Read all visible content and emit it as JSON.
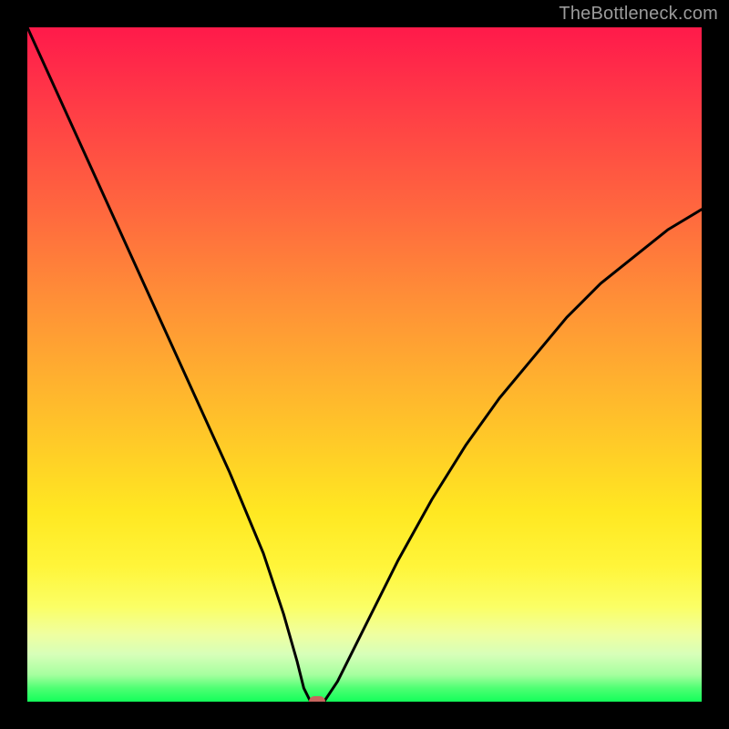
{
  "watermark": "TheBottleneck.com",
  "chart_data": {
    "type": "line",
    "title": "",
    "xlabel": "",
    "ylabel": "",
    "xlim": [
      0,
      100
    ],
    "ylim": [
      0,
      100
    ],
    "grid": false,
    "legend": false,
    "background_gradient": {
      "direction": "vertical",
      "stops": [
        {
          "pos": 0,
          "color": "#ff1a4a"
        },
        {
          "pos": 50,
          "color": "#ffb02f"
        },
        {
          "pos": 80,
          "color": "#fff53a"
        },
        {
          "pos": 100,
          "color": "#13ff5a"
        }
      ]
    },
    "series": [
      {
        "name": "bottleneck-curve",
        "x": [
          0,
          5,
          10,
          15,
          20,
          25,
          30,
          35,
          38,
          40,
          41,
          42,
          43,
          44,
          46,
          50,
          55,
          60,
          65,
          70,
          75,
          80,
          85,
          90,
          95,
          100
        ],
        "y": [
          100,
          89,
          78,
          67,
          56,
          45,
          34,
          22,
          13,
          6,
          2,
          0,
          0,
          0,
          3,
          11,
          21,
          30,
          38,
          45,
          51,
          57,
          62,
          66,
          70,
          73
        ]
      }
    ],
    "marker": {
      "x": 43,
      "y": 0,
      "color": "#c7655e"
    }
  }
}
